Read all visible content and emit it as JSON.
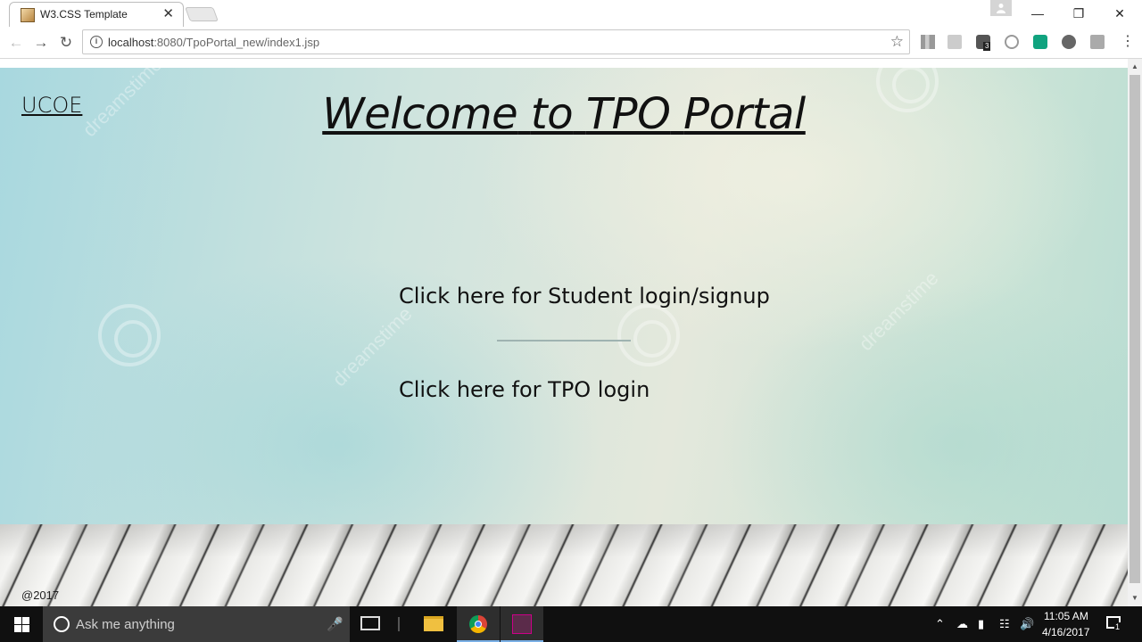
{
  "browser": {
    "tab_title": "W3.CSS Template",
    "tab_close": "✕",
    "url_host": "localhost",
    "url_rest": ":8080/TpoPortal_new/index1.jsp",
    "extension_badge": "3"
  },
  "page": {
    "brand": "UCOE",
    "welcome_words": [
      "Welcome",
      "to",
      "TPO",
      "Portal"
    ],
    "student_link": "Click here for Student login/signup",
    "tpo_link": "Click here for TPO login",
    "copyright": "@2017",
    "watermark": "dreamstime"
  },
  "taskbar": {
    "search_placeholder": "Ask me anything",
    "time": "11:05 AM",
    "date": "4/16/2017",
    "notification_count": "1"
  },
  "colors": {
    "taskbar": "#101010",
    "search_box": "#3b3b3b",
    "active_underline": "#7ab0e6"
  }
}
